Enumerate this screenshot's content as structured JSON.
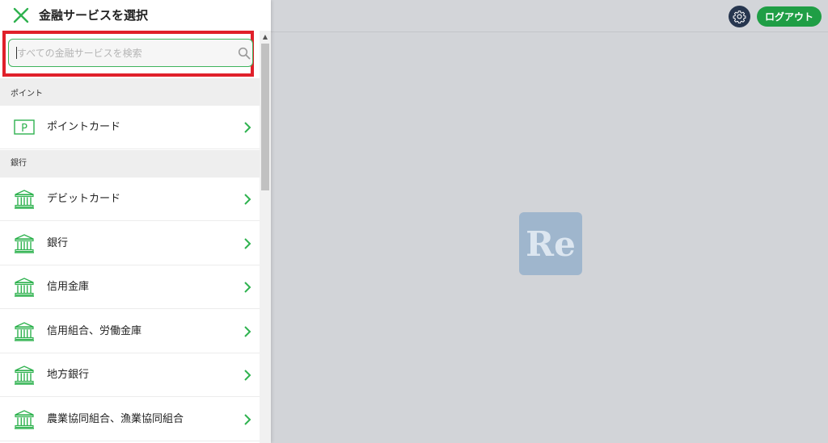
{
  "header": {
    "title": "金融サービスを選択"
  },
  "search": {
    "placeholder": "すべての金融サービスを検索"
  },
  "sections": [
    {
      "label": "ポイント",
      "items": [
        {
          "label": "ポイントカード",
          "icon": "point-card-icon"
        }
      ]
    },
    {
      "label": "銀行",
      "items": [
        {
          "label": "デビットカード",
          "icon": "bank-icon"
        },
        {
          "label": "銀行",
          "icon": "bank-icon"
        },
        {
          "label": "信用金庫",
          "icon": "bank-icon"
        },
        {
          "label": "信用組合、労働金庫",
          "icon": "bank-icon"
        },
        {
          "label": "地方銀行",
          "icon": "bank-icon"
        },
        {
          "label": "農業協同組合、漁業協同組合",
          "icon": "bank-icon"
        }
      ]
    }
  ],
  "app": {
    "logout_label": "ログアウト",
    "logo_text": "Re"
  },
  "colors": {
    "accent": "#2fb24f",
    "logout": "#1f9e45",
    "highlight": "#e0202a",
    "settings": "#27364f"
  }
}
